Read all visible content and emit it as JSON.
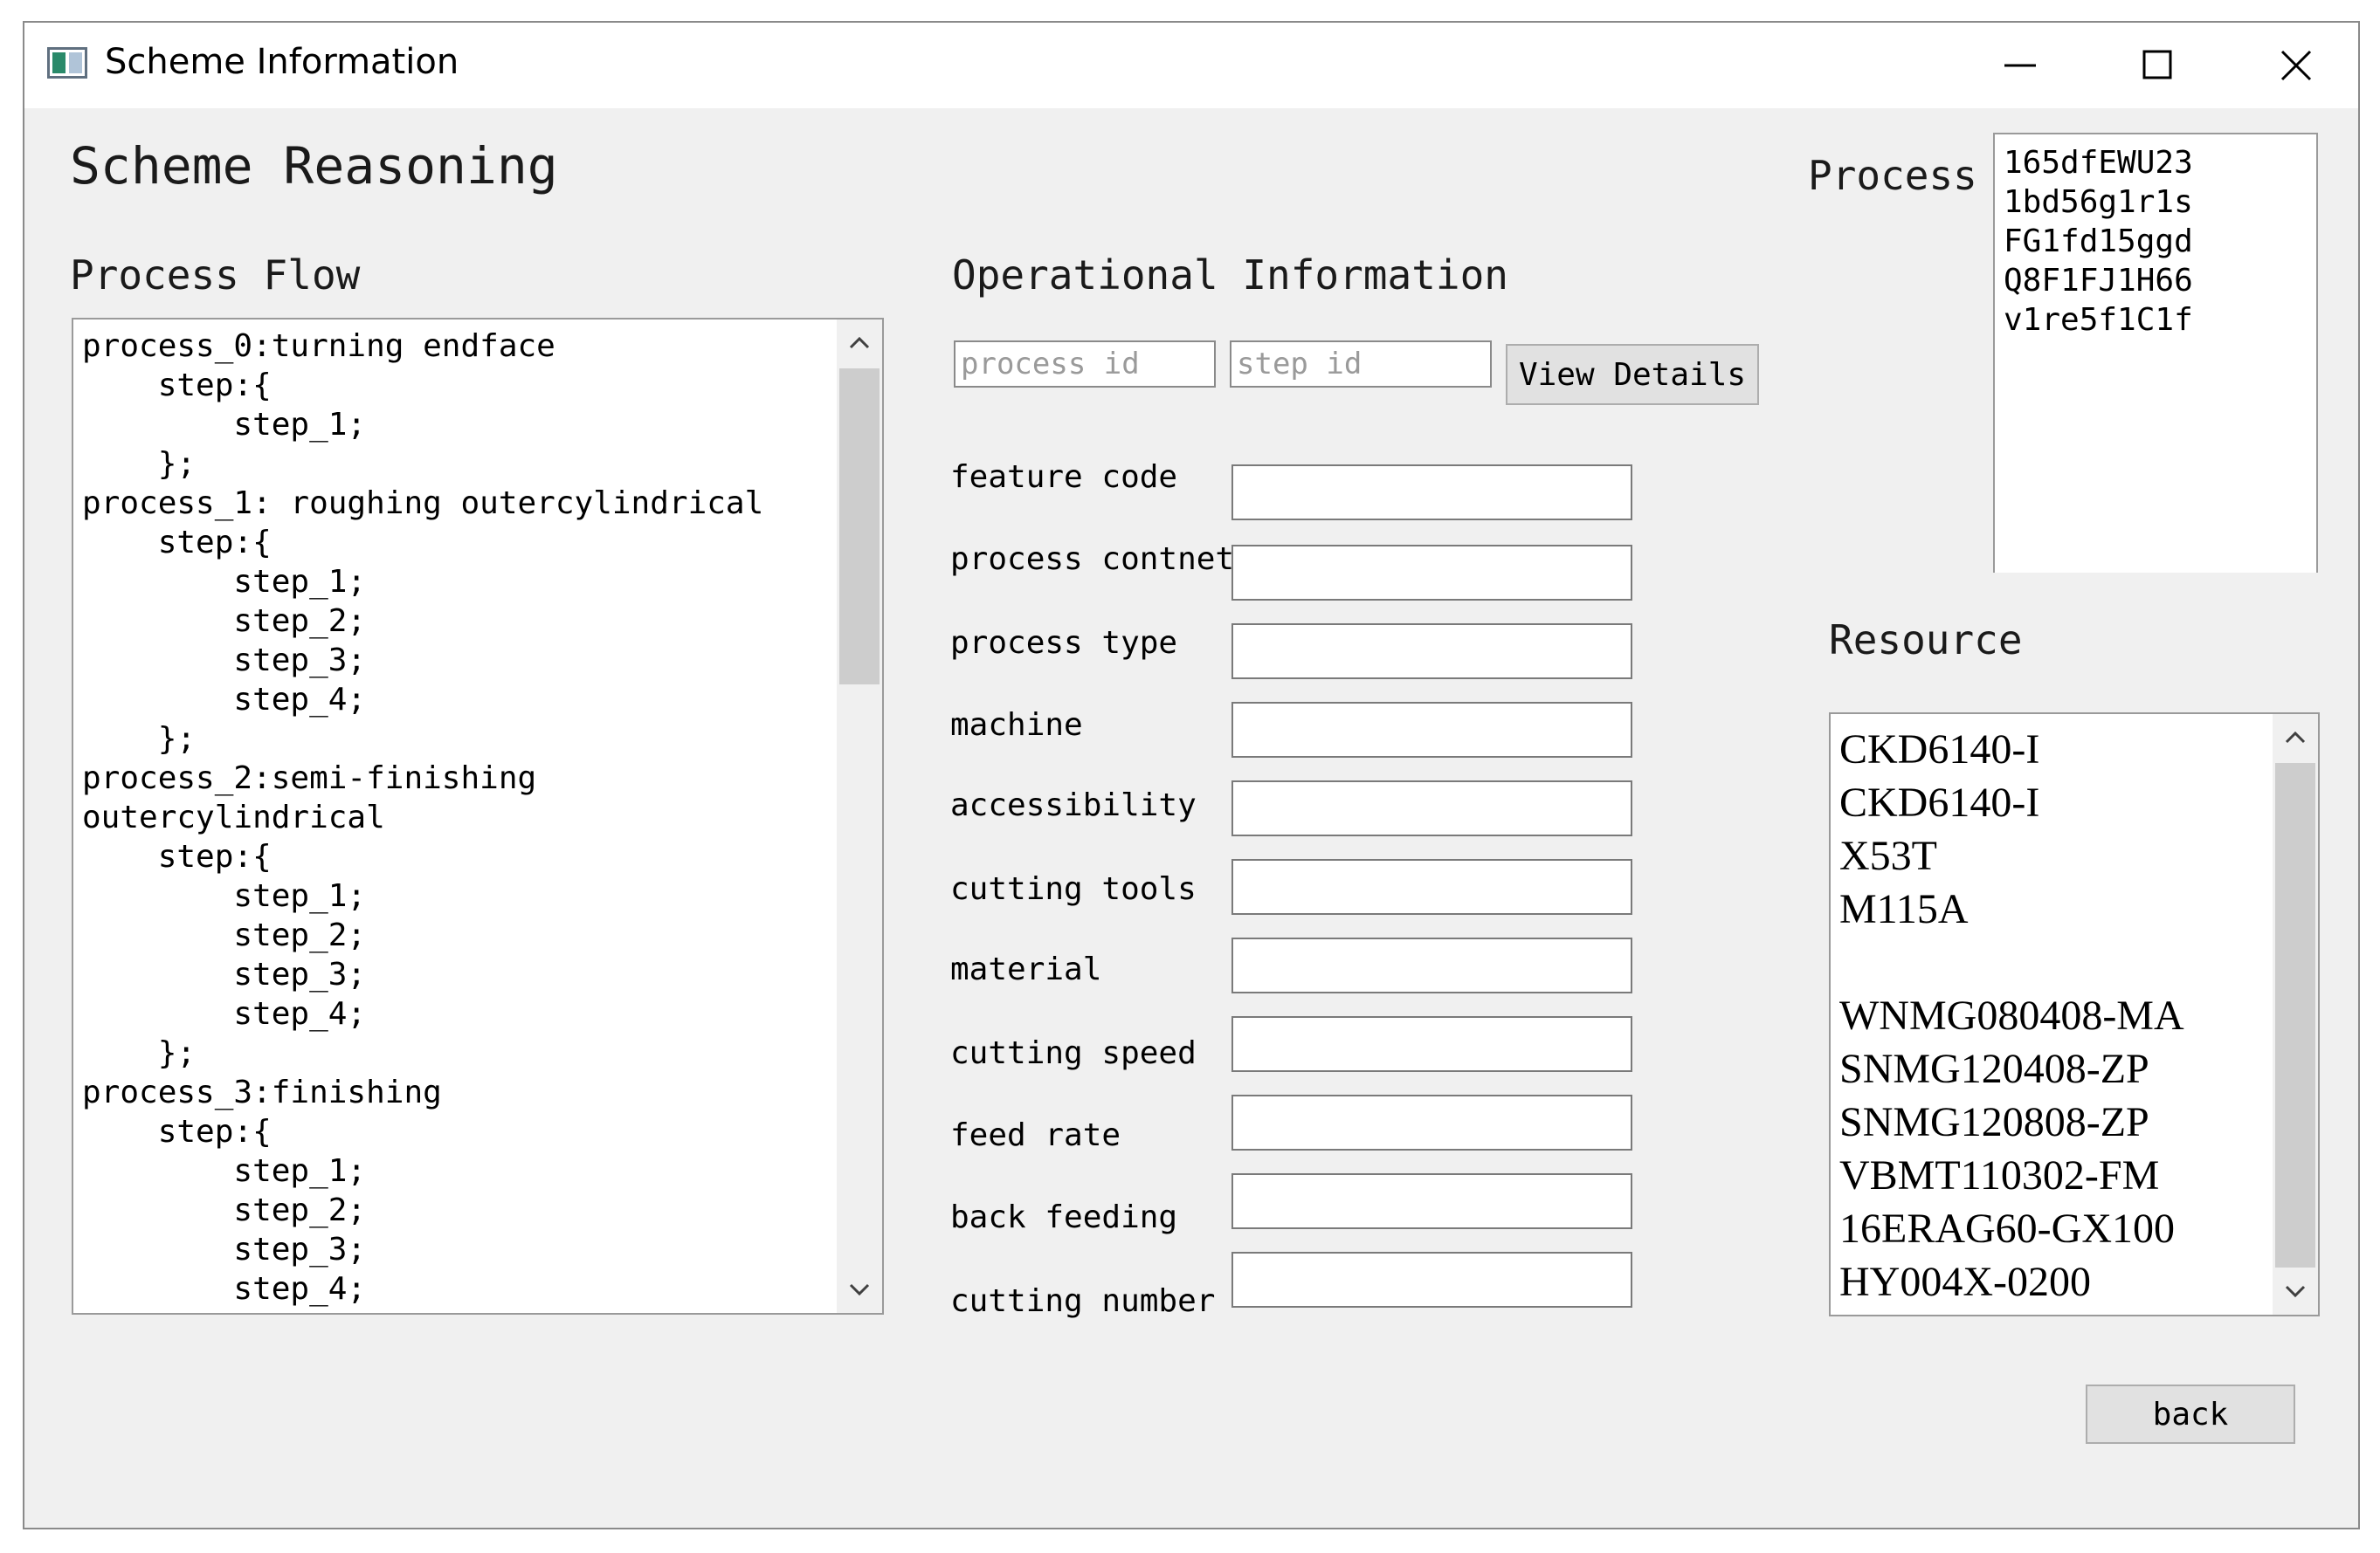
{
  "window": {
    "title": "Scheme Information"
  },
  "page": {
    "heading": "Scheme Reasoning"
  },
  "process_flow": {
    "label": "Process Flow",
    "text": "process_0:turning endface\n    step:{\n        step_1;\n    };\nprocess_1: roughing outercylindrical\n    step:{\n        step_1;\n        step_2;\n        step_3;\n        step_4;\n    };\nprocess_2:semi-finishing\noutercylindrical\n    step:{\n        step_1;\n        step_2;\n        step_3;\n        step_4;\n    };\nprocess_3:finishing\n    step:{\n        step_1;\n        step_2;\n        step_3;\n        step_4;"
  },
  "operational": {
    "label": "Operational Information",
    "process_id_placeholder": "process id",
    "step_id_placeholder": "step id",
    "view_details_label": "View Details",
    "fields": [
      {
        "label": "feature code",
        "value": ""
      },
      {
        "label": "process contnet",
        "value": ""
      },
      {
        "label": "process type",
        "value": ""
      },
      {
        "label": "machine",
        "value": ""
      },
      {
        "label": "accessibility",
        "value": ""
      },
      {
        "label": "cutting tools",
        "value": ""
      },
      {
        "label": "material",
        "value": ""
      },
      {
        "label": "cutting speed",
        "value": ""
      },
      {
        "label": "feed rate",
        "value": ""
      },
      {
        "label": "back feeding",
        "value": ""
      },
      {
        "label": "cutting number",
        "value": ""
      }
    ]
  },
  "process_panel": {
    "label": "Process",
    "items": [
      "165dfEWU23",
      "1bd56g1r1s",
      "FG1fd15ggd",
      "Q8F1FJ1H66",
      "v1re5f1C1f"
    ]
  },
  "resource": {
    "label": "Resource",
    "items": [
      "CKD6140-I",
      "CKD6140-I",
      "X53T",
      "M115A",
      "",
      "WNMG080408-MA",
      "SNMG120408-ZP",
      "SNMG120808-ZP",
      "VBMT110302-FM",
      "16ERAG60-GX100",
      "HY004X-0200"
    ]
  },
  "footer": {
    "back_label": "back"
  },
  "icons": {
    "minimize": "minimize-icon",
    "maximize": "maximize-icon",
    "close": "close-icon",
    "scroll_up": "chevron-up-icon",
    "scroll_down": "chevron-down-icon"
  }
}
